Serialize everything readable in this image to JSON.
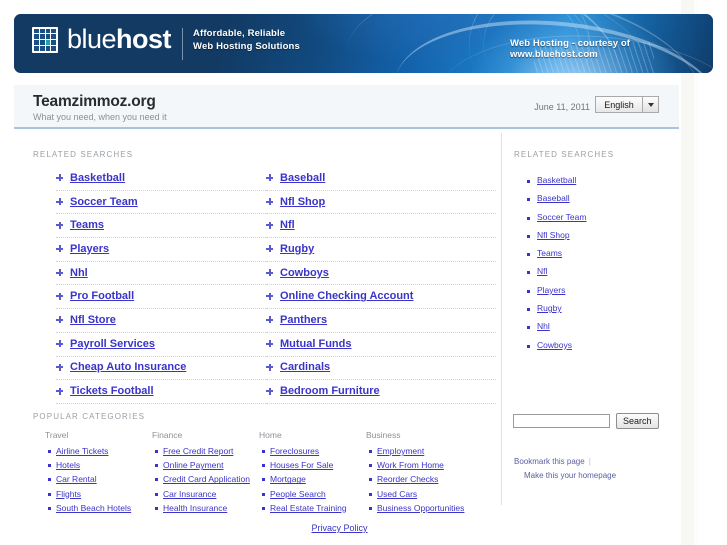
{
  "banner": {
    "logo_text_light": "blue",
    "logo_text_bold": "host",
    "tagline_line1": "Affordable, Reliable",
    "tagline_line2": "Web Hosting Solutions",
    "courtesy": "Web Hosting - courtesy of www.bluehost.com",
    "accent_color": "#1260a8",
    "logo_icon": "grid-icon"
  },
  "titlebar": {
    "site_title": "Teamzimmoz.org",
    "tagline": "What you need, when you need it",
    "date": "June 11, 2011",
    "language_value": "English",
    "language_caret_icon": "chevron-down-icon"
  },
  "main": {
    "related_searches_label": "RELATED SEARCHES",
    "popular_categories_label": "POPULAR CATEGORIES",
    "related_searches_col1": [
      "Basketball",
      "Soccer Team",
      "Teams",
      "Players",
      "Nhl",
      "Pro Football",
      "Nfl Store",
      "Payroll Services",
      "Cheap Auto Insurance",
      "Tickets Football"
    ],
    "related_searches_col2": [
      "Baseball",
      "Nfl Shop",
      "Nfl",
      "Rugby",
      "Cowboys",
      "Online Checking Account",
      "Panthers",
      "Mutual Funds",
      "Cardinals",
      "Bedroom Furniture"
    ],
    "popular_categories": [
      {
        "heading": "Travel",
        "links": [
          "Airline Tickets",
          "Hotels",
          "Car Rental",
          "Flights",
          "South Beach Hotels"
        ]
      },
      {
        "heading": "Finance",
        "links": [
          "Free Credit Report",
          "Online Payment",
          "Credit Card Application",
          "Car Insurance",
          "Health Insurance"
        ]
      },
      {
        "heading": "Home",
        "links": [
          "Foreclosures",
          "Houses For Sale",
          "Mortgage",
          "People Search",
          "Real Estate Training"
        ]
      },
      {
        "heading": "Business",
        "links": [
          "Employment",
          "Work From Home",
          "Reorder Checks",
          "Used Cars",
          "Business Opportunities"
        ]
      }
    ]
  },
  "sidebar": {
    "related_searches_label": "RELATED SEARCHES",
    "related_searches": [
      "Basketball",
      "Baseball",
      "Soccer Team",
      "Nfl Shop",
      "Teams",
      "Nfl",
      "Players",
      "Rugby",
      "Nhl",
      "Cowboys"
    ],
    "search_value": "",
    "search_placeholder": "",
    "search_button": "Search",
    "bookmark_link": "Bookmark this page",
    "homepage_link": "Make this your homepage"
  },
  "footer": {
    "privacy_policy": "Privacy Policy"
  },
  "colors": {
    "link": "#3a34c8",
    "banner_dark": "#123a63",
    "banner_light": "#2a92d8",
    "label_grey": "#9aa0a6"
  }
}
